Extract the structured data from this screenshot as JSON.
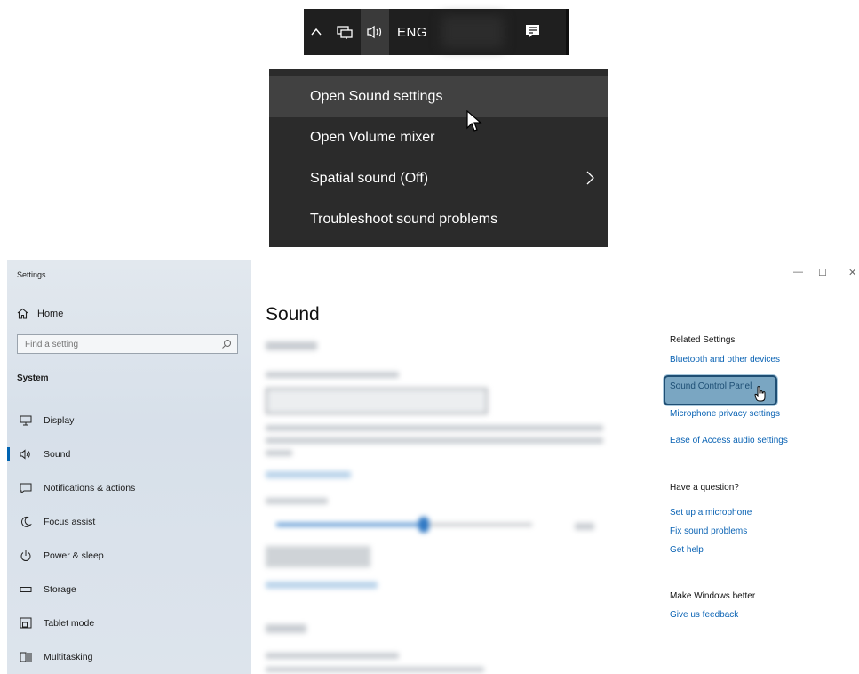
{
  "taskbar": {
    "language": "ENG",
    "icons": [
      "chevron-up-icon",
      "network-icon",
      "speaker-icon",
      "notification-center-icon"
    ]
  },
  "context_menu": {
    "items": [
      {
        "label": "Open Sound settings",
        "hovered": true
      },
      {
        "label": "Open Volume mixer"
      },
      {
        "label": "Spatial sound (Off)",
        "submenu": true
      },
      {
        "label": "Troubleshoot sound problems"
      }
    ]
  },
  "settings": {
    "app_title": "Settings",
    "home_label": "Home",
    "search_placeholder": "Find a setting",
    "section_title": "System",
    "nav_items": [
      {
        "label": "Display",
        "icon": "display-icon"
      },
      {
        "label": "Sound",
        "icon": "speaker-icon",
        "active": true
      },
      {
        "label": "Notifications & actions",
        "icon": "notifications-icon"
      },
      {
        "label": "Focus assist",
        "icon": "moon-icon"
      },
      {
        "label": "Power & sleep",
        "icon": "power-icon"
      },
      {
        "label": "Storage",
        "icon": "storage-icon"
      },
      {
        "label": "Tablet mode",
        "icon": "tablet-icon"
      },
      {
        "label": "Multitasking",
        "icon": "multitasking-icon"
      }
    ],
    "page_title": "Sound",
    "related": {
      "heading": "Related Settings",
      "links": [
        "Bluetooth and other devices",
        "Sound Control Panel",
        "Microphone privacy settings",
        "Ease of Access audio settings"
      ]
    },
    "question": {
      "heading": "Have a question?",
      "links": [
        "Set up a microphone",
        "Fix sound problems",
        "Get help"
      ]
    },
    "feedback": {
      "heading": "Make Windows better",
      "link": "Give us feedback"
    }
  },
  "colors": {
    "accent": "#0063b1",
    "link": "#0a63b4",
    "highlight_box": "#7aa6c2",
    "taskbar": "#1f1f1f",
    "menu": "#2b2b2b"
  }
}
